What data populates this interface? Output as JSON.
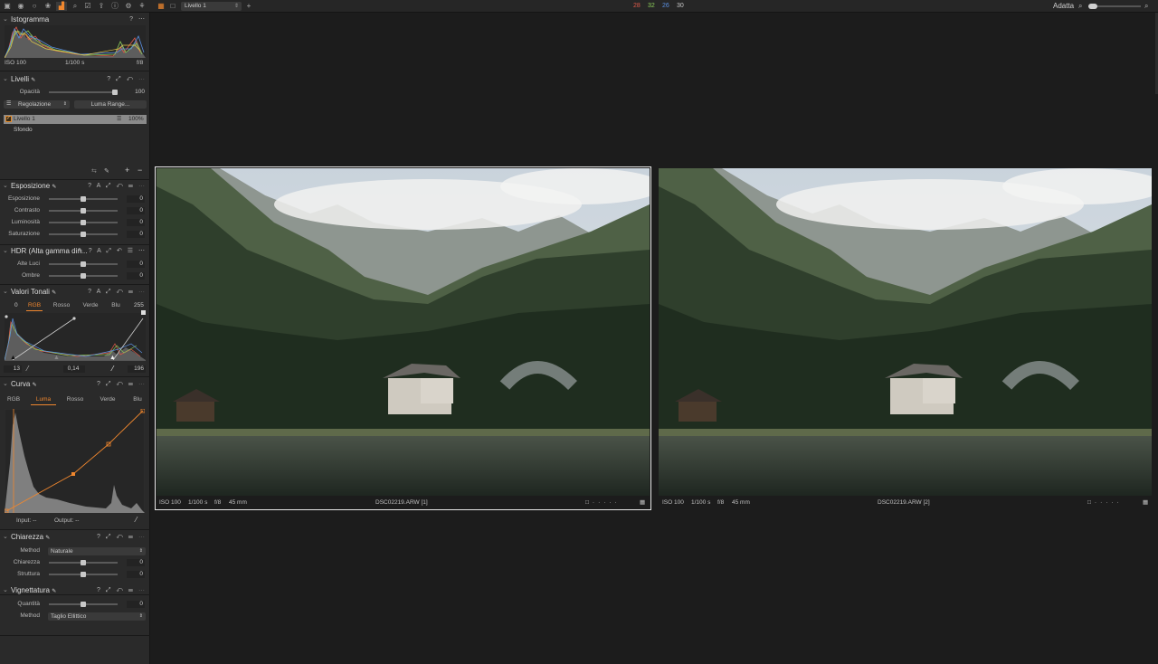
{
  "topbar": {
    "layer_select": "Livello 1",
    "counts": [
      "28",
      "32",
      "26",
      "30"
    ],
    "count_colors": [
      "#e05a4a",
      "#8ccf5a",
      "#5a8fe0",
      "#c8c8c8"
    ],
    "fit_label": "Adatta",
    "toolbar_icons": [
      "library-icon",
      "capture-icon",
      "lens-icon",
      "color-icon",
      "exposure-icon",
      "detail-icon",
      "local-adjust-icon",
      "output-icon",
      "metadata-icon",
      "settings-icon",
      "batch-icon"
    ]
  },
  "histogram": {
    "title": "Istogramma",
    "iso": "ISO 100",
    "shutter": "1/100 s",
    "aperture": "f/8"
  },
  "layers": {
    "title": "Livelli",
    "opacity_label": "Opacità",
    "opacity_value": "100",
    "opacity_level": 1.0,
    "adjust_btn": "Regolazione",
    "luma_btn": "Luma Range...",
    "layer1": "Livello 1",
    "layer1_pct": "100%",
    "background": "Sfondo"
  },
  "exposure": {
    "title": "Esposizione",
    "rows": [
      {
        "label": "Esposizione",
        "value": "0"
      },
      {
        "label": "Contrasto",
        "value": "0"
      },
      {
        "label": "Luminosità",
        "value": "0"
      },
      {
        "label": "Saturazione",
        "value": "0"
      }
    ]
  },
  "hdr": {
    "title": "HDR (Alta gamma din...",
    "rows": [
      {
        "label": "Alte Luci",
        "value": "0"
      },
      {
        "label": "Ombre",
        "value": "0"
      }
    ]
  },
  "levels": {
    "title": "Valori Tonali",
    "min": "0",
    "max": "255",
    "tabs": [
      "RGB",
      "Rosso",
      "Verde",
      "Blu"
    ],
    "low": "13",
    "mid": "0,14",
    "high": "196"
  },
  "curve": {
    "title": "Curva",
    "tabs": [
      "RGB",
      "Luma",
      "Rosso",
      "Verde",
      "Blu"
    ],
    "input_label": "Input:",
    "input_val": "--",
    "output_label": "Output:",
    "output_val": "--"
  },
  "clarity": {
    "title": "Chiarezza",
    "method_label": "Method",
    "method_value": "Naturale",
    "rows": [
      {
        "label": "Chiarezza",
        "value": "0"
      },
      {
        "label": "Struttura",
        "value": "0"
      }
    ]
  },
  "vignette": {
    "title": "Vignettatura",
    "qty_label": "Quantità",
    "qty_value": "0",
    "method_label": "Method",
    "method_value": "Taglio Ellittico"
  },
  "viewer": {
    "left": {
      "iso": "ISO 100",
      "shutter": "1/100 s",
      "aperture": "f/8",
      "focal": "45 mm",
      "file": "DSC02219.ARW [1]"
    },
    "right": {
      "iso": "ISO 100",
      "shutter": "1/100 s",
      "aperture": "f/8",
      "focal": "45 mm",
      "file": "DSC02219.ARW [2]"
    }
  }
}
